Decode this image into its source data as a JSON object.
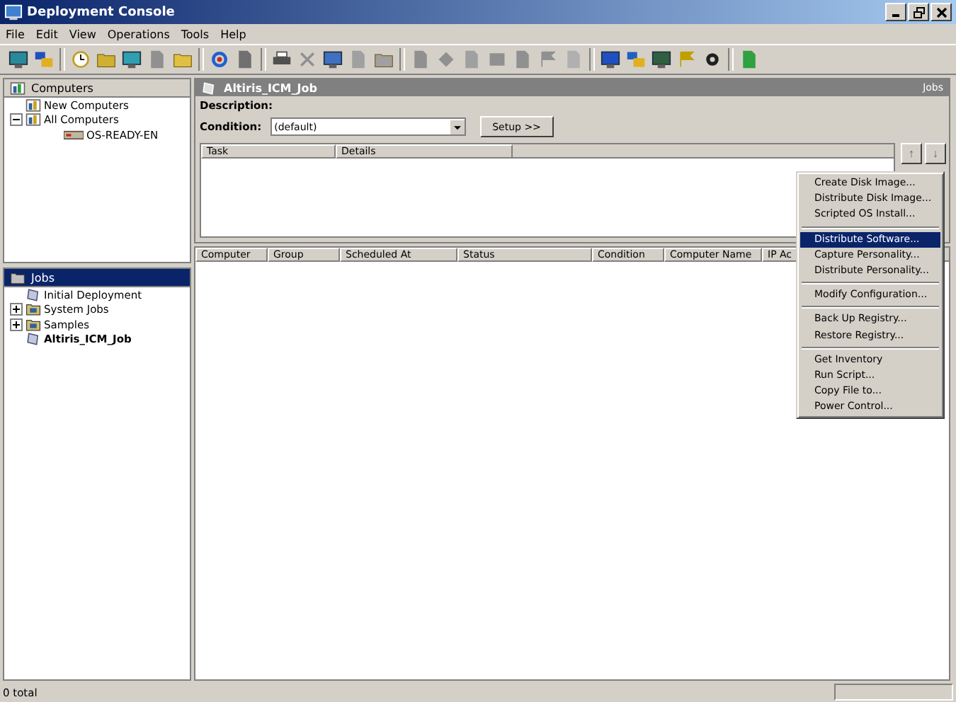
{
  "window": {
    "title": "Deployment Console"
  },
  "menubar": [
    "File",
    "Edit",
    "View",
    "Operations",
    "Tools",
    "Help"
  ],
  "computers_tree": {
    "label": "Computers",
    "children": [
      {
        "label": "New Computers",
        "active": false
      },
      {
        "label": "All Computers",
        "active": false,
        "expanded": true,
        "children": [
          {
            "label": "OS-READY-EN",
            "active": false
          }
        ]
      }
    ]
  },
  "jobs_tree": {
    "label": "Jobs",
    "selected": true,
    "children": [
      {
        "label": "Initial Deployment",
        "active": false
      },
      {
        "label": "System Jobs",
        "active": false,
        "expanded": false
      },
      {
        "label": "Samples",
        "active": false,
        "expanded": false
      },
      {
        "label": "Altiris_ICM_Job",
        "active": true
      }
    ]
  },
  "job_panel": {
    "title": "Altiris_ICM_Job",
    "caption_right": "Jobs",
    "description_label": "Description:",
    "condition_label": "Condition:",
    "condition_value": "(default)",
    "setup_button": "Setup >>",
    "task_columns": [
      "Task",
      "Details"
    ],
    "move_buttons": [
      "↑",
      "↓"
    ]
  },
  "computer_columns": [
    "Computer",
    "Group",
    "Scheduled At",
    "Status",
    "Condition",
    "Computer Name",
    "IP Ac"
  ],
  "context_menu": [
    [
      {
        "label": "Create Disk Image...",
        "selected": false
      },
      {
        "label": "Distribute Disk Image...",
        "selected": false
      },
      {
        "label": "Scripted OS Install...",
        "selected": false
      }
    ],
    [
      {
        "label": "Distribute Software...",
        "selected": true
      },
      {
        "label": "Capture Personality...",
        "selected": false
      },
      {
        "label": "Distribute Personality...",
        "selected": false
      }
    ],
    [
      {
        "label": "Modify Configuration...",
        "selected": false
      }
    ],
    [
      {
        "label": "Back Up Registry...",
        "selected": false
      },
      {
        "label": "Restore Registry...",
        "selected": false
      }
    ],
    [
      {
        "label": "Get Inventory",
        "selected": false
      },
      {
        "label": "Run Script...",
        "selected": false
      },
      {
        "label": "Copy File to...",
        "selected": false
      },
      {
        "label": "Power Control...",
        "selected": false
      }
    ]
  ],
  "status_bar": {
    "text": "0 total"
  }
}
